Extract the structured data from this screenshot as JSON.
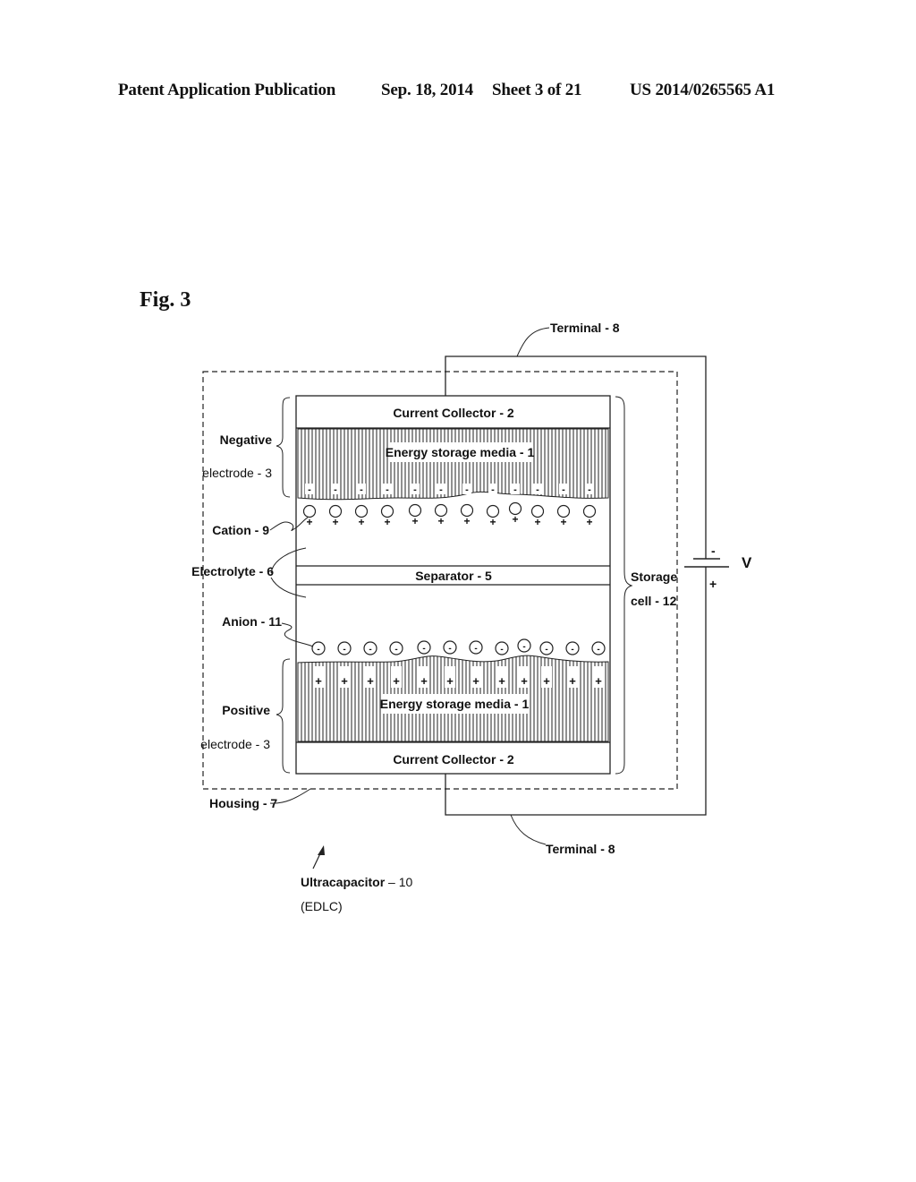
{
  "header": {
    "publication": "Patent Application Publication",
    "date": "Sep. 18, 2014",
    "sheet": "Sheet 3 of 21",
    "number": "US 2014/0265565 A1"
  },
  "figure": {
    "title": "Fig. 3",
    "labels": {
      "terminal_top": "Terminal - 8",
      "terminal_bottom": "Terminal - 8",
      "current_collector_top": "Current Collector - 2",
      "current_collector_bottom": "Current Collector - 2",
      "energy_media_top": "Energy storage media - 1",
      "energy_media_bottom": "Energy storage media - 1",
      "negative": "Negative",
      "negative_electrode": "electrode - 3",
      "positive": "Positive",
      "positive_electrode": "electrode - 3",
      "cation": "Cation - 9",
      "electrolyte": "Electrolyte - 6",
      "separator": "Separator - 5",
      "anion": "Anion - 11",
      "storage": "Storage",
      "storage_cell": "cell - 12",
      "voltage": "V",
      "battery_minus": "-",
      "battery_plus": "+",
      "housing": "Housing - 7",
      "ultracapacitor_bold": "Ultracapacitor",
      "ultracapacitor_num": " – 10",
      "edlc": "(EDLC)"
    },
    "ion_count": 12,
    "cation_symbol": "+",
    "anion_symbol": "-",
    "negative_charge_symbol": "-",
    "positive_charge_symbol": "+"
  }
}
